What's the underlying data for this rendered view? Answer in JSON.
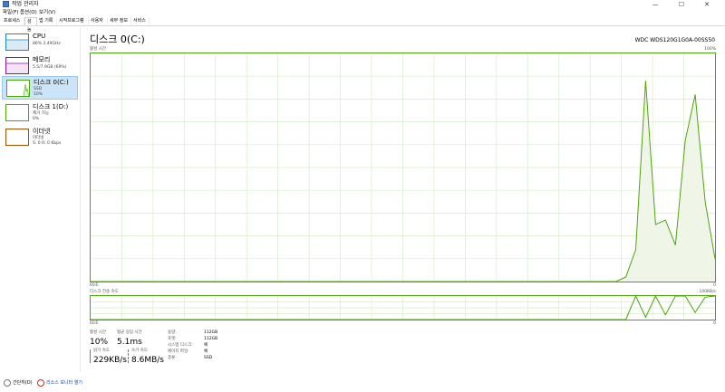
{
  "window": {
    "title": "작업 관리자",
    "minimize": "—",
    "maximize": "☐",
    "close": "✕"
  },
  "menu": [
    "파일(F)",
    "옵션(O)",
    "보기(V)"
  ],
  "tabs": [
    "프로세스",
    "성능",
    "앱 기록",
    "시작프로그램",
    "사용자",
    "세부 정보",
    "서비스"
  ],
  "active_tab": 1,
  "sidebar": [
    {
      "name": "CPU",
      "sub1": "86% 3.49GHz",
      "sub2": "",
      "color": "#1785c9"
    },
    {
      "name": "메모리",
      "sub1": "5.5/7.9GB (69%)",
      "sub2": "",
      "color": "#8b12ae"
    },
    {
      "name": "디스크 0(C:)",
      "sub1": "SSD",
      "sub2": "10%",
      "color": "#4da60c"
    },
    {
      "name": "디스크 1(D:)",
      "sub1": "제거 가능",
      "sub2": "0%",
      "color": "#4da60c"
    },
    {
      "name": "이더넷",
      "sub1": "이더넷",
      "sub2": "S: 0 R: 0 Kbps",
      "color": "#a74f01"
    }
  ],
  "main": {
    "title": "디스크 0(C:)",
    "model": "WDC WDS120G1G0A-00SS50",
    "active_time_label": "활성 시간",
    "pct_max": "100%",
    "seconds_label": "60초",
    "zero": "0",
    "transfer_label": "디스크 전송 속도",
    "transfer_max": "100KB/s",
    "zero2": "0"
  },
  "stats": {
    "active_time": {
      "label": "활성 시간",
      "value": "10%"
    },
    "avg_response": {
      "label": "평균 응답 시간",
      "value": "5.1ms"
    },
    "read_speed": {
      "label": "읽기 속도",
      "value": "229KB/s"
    },
    "write_speed": {
      "label": "쓰기 속도",
      "value": "8.6MB/s"
    }
  },
  "properties": [
    {
      "label": "용량:",
      "value": "112GB"
    },
    {
      "label": "포맷:",
      "value": "112GB"
    },
    {
      "label": "시스템 디스크:",
      "value": "예"
    },
    {
      "label": "페이지 파일:",
      "value": "예"
    },
    {
      "label": "종류:",
      "value": "SSD"
    }
  ],
  "footer": {
    "brief": "간단히(D)",
    "monitor": "리소스 모니터 열기"
  },
  "colors": {
    "disk": "#4da60c",
    "disk_fill": "#eff6e8",
    "grid": "#d9eccb",
    "selected": "#cce4f7"
  },
  "chart_data": {
    "type": "area",
    "title": "활성 시간",
    "series": [
      {
        "name": "활성 시간",
        "values": [
          0,
          0,
          0,
          0,
          0,
          0,
          0,
          0,
          0,
          0,
          0,
          0,
          0,
          0,
          0,
          0,
          0,
          0,
          0,
          0,
          0,
          0,
          0,
          0,
          0,
          0,
          0,
          0,
          0,
          0,
          0,
          0,
          0,
          0,
          0,
          0,
          0,
          0,
          0,
          0,
          0,
          0,
          0,
          0,
          0,
          0,
          0,
          0,
          0,
          0,
          0,
          0,
          0,
          0,
          2,
          14,
          88,
          25,
          27,
          16,
          62,
          82,
          35,
          10
        ]
      }
    ],
    "ylim": [
      0,
      100
    ],
    "xlabel": "60초",
    "grid": true
  },
  "transfer_chart": {
    "type": "line",
    "title": "디스크 전송 속도",
    "series": [
      {
        "name": "읽기",
        "values": [
          0,
          0,
          0,
          0,
          0,
          0,
          0,
          0,
          0,
          0,
          0,
          0,
          0,
          0,
          0,
          0,
          0,
          0,
          0,
          0,
          0,
          0,
          0,
          0,
          0,
          0,
          0,
          0,
          0,
          0,
          0,
          0,
          0,
          0,
          0,
          0,
          0,
          0,
          0,
          0,
          0,
          0,
          0,
          0,
          0,
          0,
          0,
          0,
          0,
          0,
          0,
          0,
          0,
          0,
          0,
          100,
          10,
          100,
          20,
          100,
          100,
          30,
          95,
          100
        ]
      }
    ],
    "ylim": [
      0,
      100
    ]
  }
}
